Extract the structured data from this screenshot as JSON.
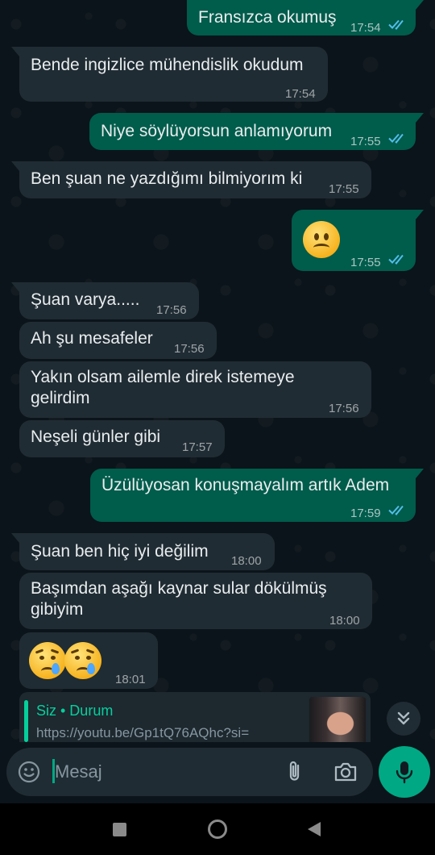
{
  "messages": [
    {
      "dir": "out",
      "text": "Fransızca okumuş",
      "time": "17:54",
      "read": true
    },
    {
      "dir": "in",
      "text": "Bende ingizlice mühendislik okudum",
      "time": "17:54"
    },
    {
      "dir": "out",
      "text": "Niye söylüyorsun anlamıyorum",
      "time": "17:55",
      "read": true
    },
    {
      "dir": "in",
      "text": "Ben şuan ne yazdığımı bilmiyorım ki",
      "time": "17:55"
    },
    {
      "dir": "out",
      "emoji": "frowning-face",
      "time": "17:55",
      "read": true
    },
    {
      "dir": "in",
      "text": "Şuan varya.....",
      "time": "17:56"
    },
    {
      "dir": "in",
      "text": "Ah şu mesafeler",
      "time": "17:56"
    },
    {
      "dir": "in",
      "text": "Yakın olsam ailemle direk istemeye gelirdim",
      "time": "17:56"
    },
    {
      "dir": "in",
      "text": "Neşeli günler gibi",
      "time": "17:57"
    },
    {
      "dir": "out",
      "text": "Üzülüyosan konuşmayalım artık Adem",
      "time": "17:59",
      "read": true
    },
    {
      "dir": "in",
      "text": "Şuan ben hiç iyi değilim",
      "time": "18:00"
    },
    {
      "dir": "in",
      "text": "Başımdan aşağı kaynar sular dökülmüş gibiyim",
      "time": "18:00"
    },
    {
      "dir": "in",
      "emoji": "crying-face-x2",
      "time": "18:01"
    }
  ],
  "reply_preview": {
    "author": "Siz • Durum",
    "link": "https://youtu.be/Gp1tQ76AQhc?si="
  },
  "composer": {
    "placeholder": "Mesaj"
  },
  "colors": {
    "background": "#0b141a",
    "incoming_bubble": "#202c33",
    "outgoing_bubble": "#005c4b",
    "accent": "#00a884",
    "read_ticks": "#53bdeb"
  },
  "icons": {
    "composer": [
      "emoji-icon",
      "attach-icon",
      "camera-icon",
      "mic-icon"
    ],
    "navigation": [
      "recent-apps-icon",
      "home-icon",
      "back-icon"
    ],
    "scroll": "scroll-down-icon"
  }
}
